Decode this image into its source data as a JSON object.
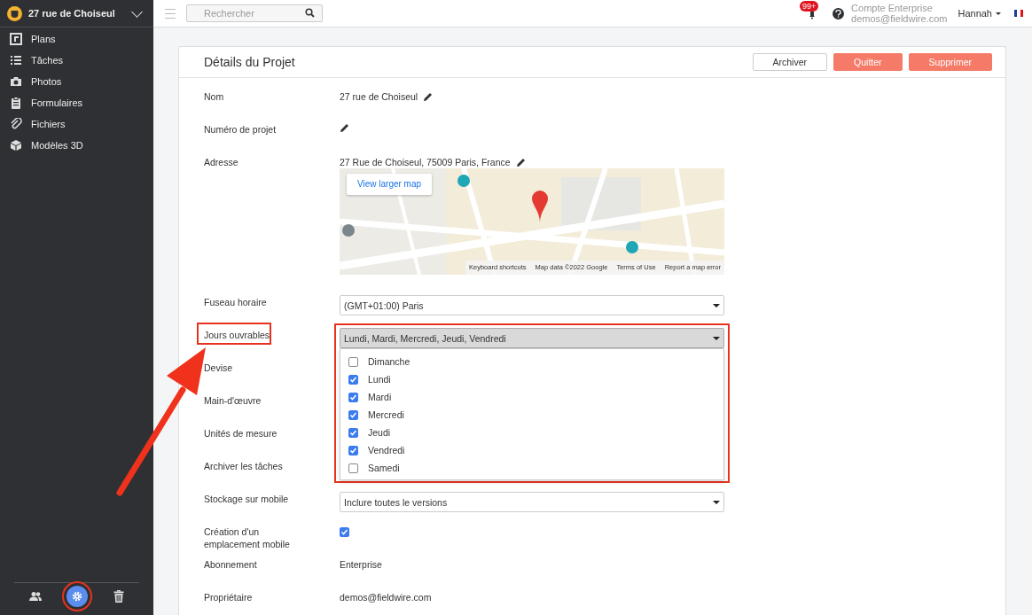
{
  "sidebar": {
    "project": "27 rue de Choiseul",
    "items": [
      {
        "label": "Plans"
      },
      {
        "label": "Tâches"
      },
      {
        "label": "Photos"
      },
      {
        "label": "Formulaires"
      },
      {
        "label": "Fichiers"
      },
      {
        "label": "Modèles 3D"
      }
    ],
    "footer": [
      {
        "selected": false,
        "highlighted": false
      },
      {
        "selected": true,
        "highlighted": true
      },
      {
        "selected": false,
        "highlighted": false
      }
    ]
  },
  "topbar": {
    "search": {
      "placeholder": "Rechercher"
    },
    "notifications": "99+",
    "account": {
      "plan": "Compte Enterprise",
      "email": "demos@fieldwire.com"
    },
    "user": "Hannah"
  },
  "card": {
    "title": "Détails du Projet",
    "buttons": [
      {
        "label": "Archiver",
        "kind": "outline"
      },
      {
        "label": "Quitter",
        "kind": "danger"
      },
      {
        "label": "Supprimer",
        "kind": "danger"
      }
    ],
    "rows": [
      {
        "label": "Nom",
        "kind": "edit",
        "value": "27 rue de Choiseul"
      },
      {
        "label": "Numéro de projet",
        "kind": "edit"
      },
      {
        "label": "Adresse",
        "kind": "edit",
        "value": "27 Rue de Choiseul, 75009 Paris, France"
      },
      {
        "kind": "map",
        "map_button": "View larger map",
        "attribution": [
          "Keyboard shortcuts",
          "Map data ©2022 Google",
          "Terms of Use",
          "Report a map error"
        ]
      },
      {
        "label": "Fuseau horaire",
        "kind": "select",
        "value": "(GMT+01:00) Paris"
      },
      {
        "label": "Jours ouvrables",
        "kind": "multiselect",
        "value": "Lundi, Mardi, Mercredi, Jeudi, Vendredi",
        "highlighted": true,
        "expanded": true,
        "options": [
          {
            "label": "Dimanche",
            "checked": false
          },
          {
            "label": "Lundi",
            "checked": true
          },
          {
            "label": "Mardi",
            "checked": true
          },
          {
            "label": "Mercredi",
            "checked": true
          },
          {
            "label": "Jeudi",
            "checked": true
          },
          {
            "label": "Vendredi",
            "checked": true
          },
          {
            "label": "Samedi",
            "checked": false
          }
        ]
      },
      {
        "label": "Devise",
        "kind": "covered"
      },
      {
        "label": "Main-d'œuvre",
        "kind": "covered"
      },
      {
        "label": "Unités de mesure",
        "kind": "covered"
      },
      {
        "label": "Archiver les tâches",
        "kind": "covered"
      },
      {
        "label": "Stockage sur mobile",
        "kind": "select",
        "value": "Inclure toutes le versions"
      },
      {
        "label": "Création d'un emplacement mobile",
        "kind": "checkbox",
        "checked": true
      },
      {
        "label": "Abonnement",
        "kind": "text",
        "value": "Enterprise"
      },
      {
        "label": "Propriétaire",
        "kind": "text",
        "value": "demos@fieldwire.com"
      }
    ]
  },
  "annotation_arrow": true
}
